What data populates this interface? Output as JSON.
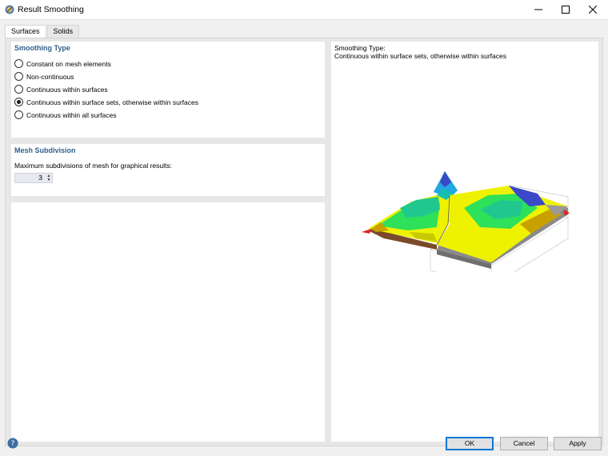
{
  "window": {
    "title": "Result Smoothing",
    "icon": "app-logo-icon"
  },
  "tabs": [
    {
      "label": "Surfaces",
      "active": true
    },
    {
      "label": "Solids",
      "active": false
    }
  ],
  "smoothing": {
    "title": "Smoothing Type",
    "options": [
      {
        "label": "Constant on mesh elements",
        "selected": false
      },
      {
        "label": "Non-continuous",
        "selected": false
      },
      {
        "label": "Continuous within surfaces",
        "selected": false
      },
      {
        "label": "Continuous within surface sets, otherwise within surfaces",
        "selected": true
      },
      {
        "label": "Continuous within all surfaces",
        "selected": false
      }
    ]
  },
  "mesh": {
    "title": "Mesh Subdivision",
    "label": "Maximum subdivisions of mesh for graphical results:",
    "value": "3"
  },
  "preview": {
    "title": "Smoothing Type:",
    "value": "Continuous within surface sets, otherwise within surfaces"
  },
  "buttons": {
    "ok": "OK",
    "cancel": "Cancel",
    "apply": "Apply"
  },
  "colors": {
    "accent": "#0078d7",
    "section_title": "#2f5f8d"
  }
}
